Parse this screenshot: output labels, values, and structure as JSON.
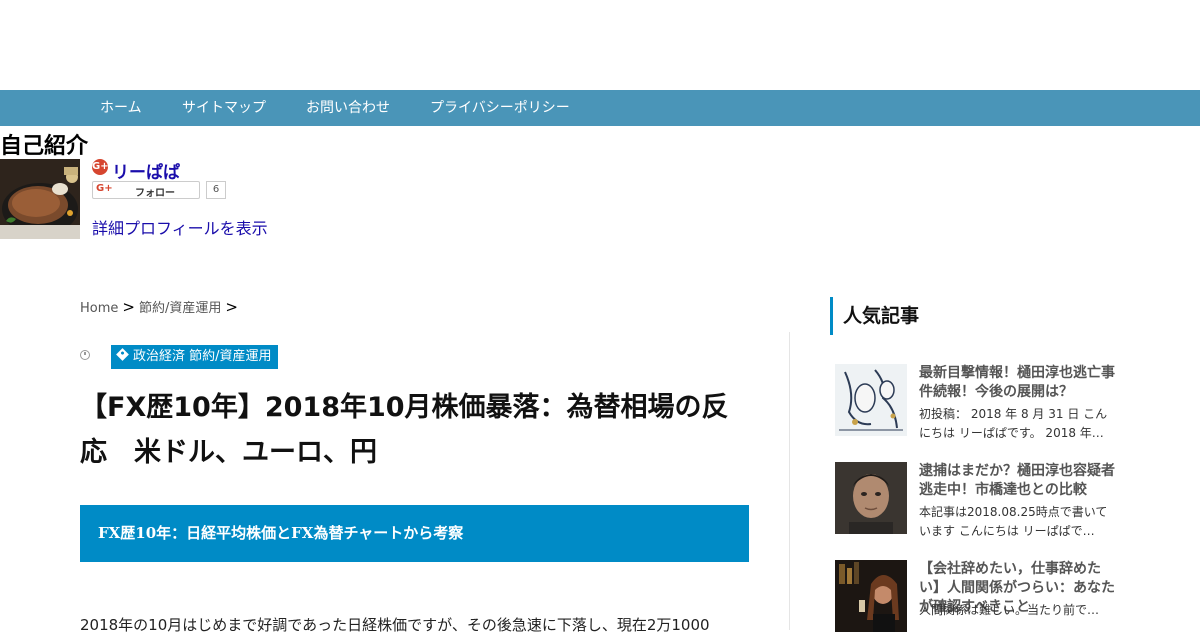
{
  "nav": {
    "items": [
      "ホーム",
      "サイトマップ",
      "お問い合わせ",
      "プライバシーポリシー"
    ],
    "color": "#4a95b8"
  },
  "profile": {
    "title": "自己紹介",
    "name": "リーぱぱ",
    "gplus_badge": "G+",
    "follow_label": "フォロー",
    "follow_gp": "G+",
    "follow_count": "6",
    "detail_link": "詳細プロフィールを表示"
  },
  "breadcrumb": {
    "home": "Home",
    "category": "節約/資産運用",
    "separator": ">"
  },
  "post": {
    "categories": "政治経済 節約/資産運用",
    "title": "【FX歴10年】2018年10月株価暴落：為替相場の反応　米ドル、ユーロ、円",
    "subheading": "FX歴10年：日経平均株価とFX為替チャートから考察",
    "body_first_line": "2018年の10月はじめまで好調であった日経株価ですが、その後急速に下落し、現在2万1000",
    "accent_color": "#008bc6"
  },
  "sidebar": {
    "heading": "人気記事",
    "items": [
      {
        "title": "最新目撃情報！樋田淳也逃亡事件続報！今後の展開は？",
        "excerpt": "初投稿： 2018 年 8 月 31 日 こんにちは リーぱぱです。 2018 年…"
      },
      {
        "title": "逮捕はまだか？樋田淳也容疑者逃走中！市橋達也との比較",
        "excerpt": "本記事は2018.08.25時点で書いています こんにちは リーぱぱで…"
      },
      {
        "title": "【会社辞めたい，仕事辞めたい】人間関係がつらい：あなたが確認すべきこと",
        "excerpt": "人間関係は難しい。当たり前で…"
      }
    ]
  }
}
